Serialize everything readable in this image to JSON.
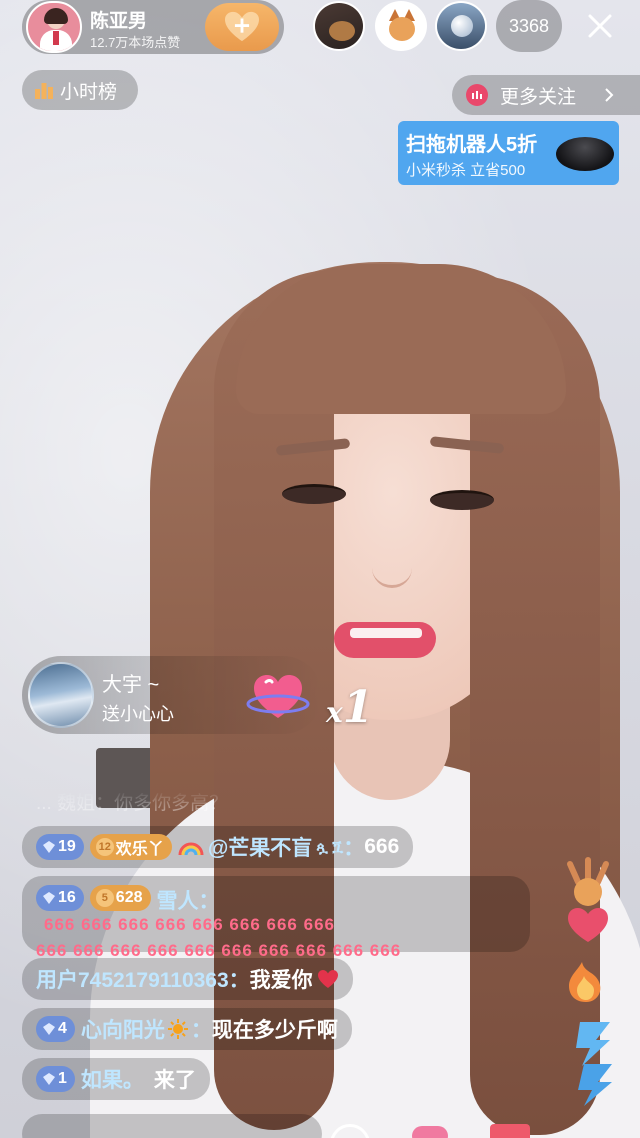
{
  "host": {
    "name": "陈亚男",
    "likes": "12.7万本场点赞"
  },
  "viewers": {
    "count": "3368"
  },
  "hourly_rank": {
    "label": "小时榜"
  },
  "more_follow": {
    "label": "更多关注"
  },
  "promo": {
    "title": "扫拖机器人5折",
    "subtitle": "小米秒杀 立省500"
  },
  "gift": {
    "sender": "大宇 ~",
    "action": "送小心心",
    "combo_prefix": "x",
    "combo_count": "1"
  },
  "chat": {
    "faded_line": "... 魏姐：你多你多高？",
    "messages": [
      {
        "levels": [
          {
            "type": "blue",
            "value": "19"
          },
          {
            "type": "gold",
            "value": "12",
            "tag": "欢乐丫"
          }
        ],
        "user": "@芒果不盲",
        "user_suffix": "ጷ ጟ",
        "text": "666"
      },
      {
        "levels": [
          {
            "type": "blue",
            "value": "16"
          },
          {
            "type": "gold",
            "value": "5",
            "tag": "628"
          }
        ],
        "user": "雪人",
        "text_line1": "666 666 666 666 666 666 666 666",
        "text_line2": "666 666 666 666 666 666 666 666 666 666"
      },
      {
        "user": "用户7452179110363",
        "text": "我爱你"
      },
      {
        "levels": [
          {
            "type": "blue",
            "value": "4"
          }
        ],
        "user": "心向阳光",
        "text": "现在多少斤啊"
      },
      {
        "levels": [
          {
            "type": "blue",
            "value": "1"
          }
        ],
        "user": "如果。",
        "text": "来了"
      }
    ]
  },
  "colors": {
    "promo_bg": "#50a6ef",
    "follow_btn": "#e99a4c",
    "level_blue": "#6e8fd8",
    "level_gold": "#e6a24a",
    "username": "#bfe6ff",
    "spam_pink": "#ff6b8a"
  },
  "icons": [
    "heart-plus-icon",
    "close-icon",
    "rank-bars-icon",
    "chevron-right-icon",
    "planet-heart-icon",
    "rainbow-icon",
    "red-heart-icon",
    "sun-icon",
    "level-gem-icon"
  ]
}
